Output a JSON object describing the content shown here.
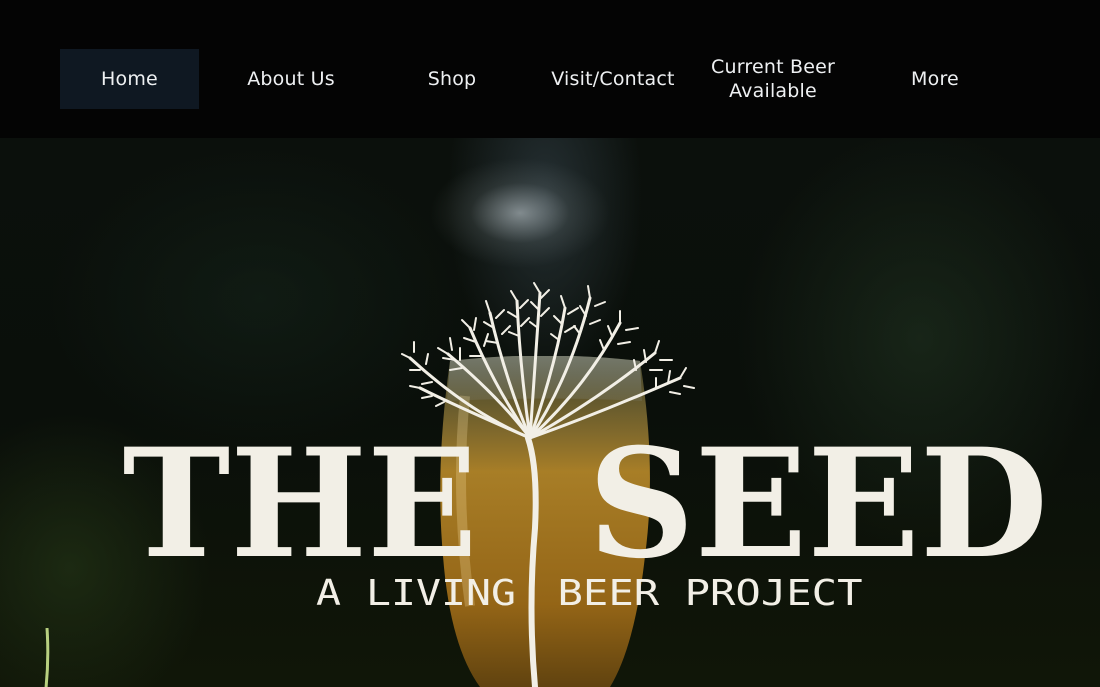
{
  "nav": {
    "items": [
      {
        "label": "Home",
        "active": true
      },
      {
        "label": "About Us"
      },
      {
        "label": "Shop"
      },
      {
        "label": "Visit/Contact"
      },
      {
        "label_line1": "Current Beer",
        "label_line2": "Available"
      },
      {
        "label": "More"
      }
    ]
  },
  "hero": {
    "title_left": "THE",
    "title_right": "SEED",
    "subtitle_left": "A LIVING",
    "subtitle_right": "BEER PROJECT",
    "logo_icon": "tree-icon"
  }
}
